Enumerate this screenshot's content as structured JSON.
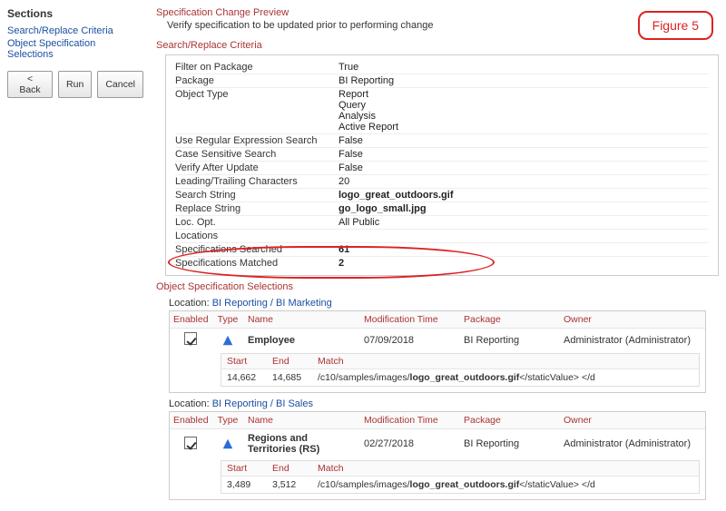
{
  "figure_label": "Figure 5",
  "sidebar": {
    "heading": "Sections",
    "links": [
      "Search/Replace Criteria",
      "Object Specification Selections"
    ],
    "buttons": {
      "back": "< Back",
      "run": "Run",
      "cancel": "Cancel"
    }
  },
  "preview": {
    "title": "Specification Change Preview",
    "subtitle": "Verify specification to be updated prior to performing change"
  },
  "criteria": {
    "heading": "Search/Replace Criteria",
    "rows": [
      {
        "label": "Filter on Package",
        "value": "True"
      },
      {
        "label": "Package",
        "value": "BI Reporting"
      },
      {
        "label": "Object Type",
        "value": "Report\nQuery\nAnalysis\nActive Report"
      },
      {
        "label": "Use Regular Expression Search",
        "value": "False"
      },
      {
        "label": "Case Sensitive Search",
        "value": "False"
      },
      {
        "label": "Verify After Update",
        "value": "False"
      },
      {
        "label": "Leading/Trailing Characters",
        "value": "20"
      },
      {
        "label": "Search String",
        "value": "logo_great_outdoors.gif",
        "bold": true
      },
      {
        "label": "Replace String",
        "value": "go_logo_small.jpg",
        "bold": true
      },
      {
        "label": "Loc. Opt.",
        "value": "All Public"
      },
      {
        "label": "Locations",
        "value": ""
      },
      {
        "label": "Specifications Searched",
        "value": "61",
        "bold": true
      },
      {
        "label": "Specifications Matched",
        "value": "2",
        "bold": true
      }
    ]
  },
  "selections": {
    "heading": "Object Specification Selections",
    "location_label": "Location:",
    "columns": {
      "enabled": "Enabled",
      "type": "Type",
      "name": "Name",
      "mtime": "Modification Time",
      "package": "Package",
      "owner": "Owner",
      "start": "Start",
      "end": "End",
      "match": "Match"
    },
    "locations": [
      {
        "path": "BI Reporting / BI Marketing",
        "item": {
          "enabled": true,
          "name": "Employee",
          "mtime": "07/09/2018",
          "package": "BI Reporting",
          "owner": "Administrator (Administrator)",
          "match": {
            "start": "14,662",
            "end": "14,685",
            "prefix": "/c10/samples/images/",
            "strong": "logo_great_outdoors.gif",
            "suffix": "</staticValue> </d"
          }
        }
      },
      {
        "path": "BI Reporting / BI Sales",
        "item": {
          "enabled": true,
          "name": "Regions and Territories (RS)",
          "mtime": "02/27/2018",
          "package": "BI Reporting",
          "owner": "Administrator (Administrator)",
          "match": {
            "start": "3,489",
            "end": "3,512",
            "prefix": "/c10/samples/images/",
            "strong": "logo_great_outdoors.gif",
            "suffix": "</staticValue> </d"
          }
        }
      }
    ]
  }
}
